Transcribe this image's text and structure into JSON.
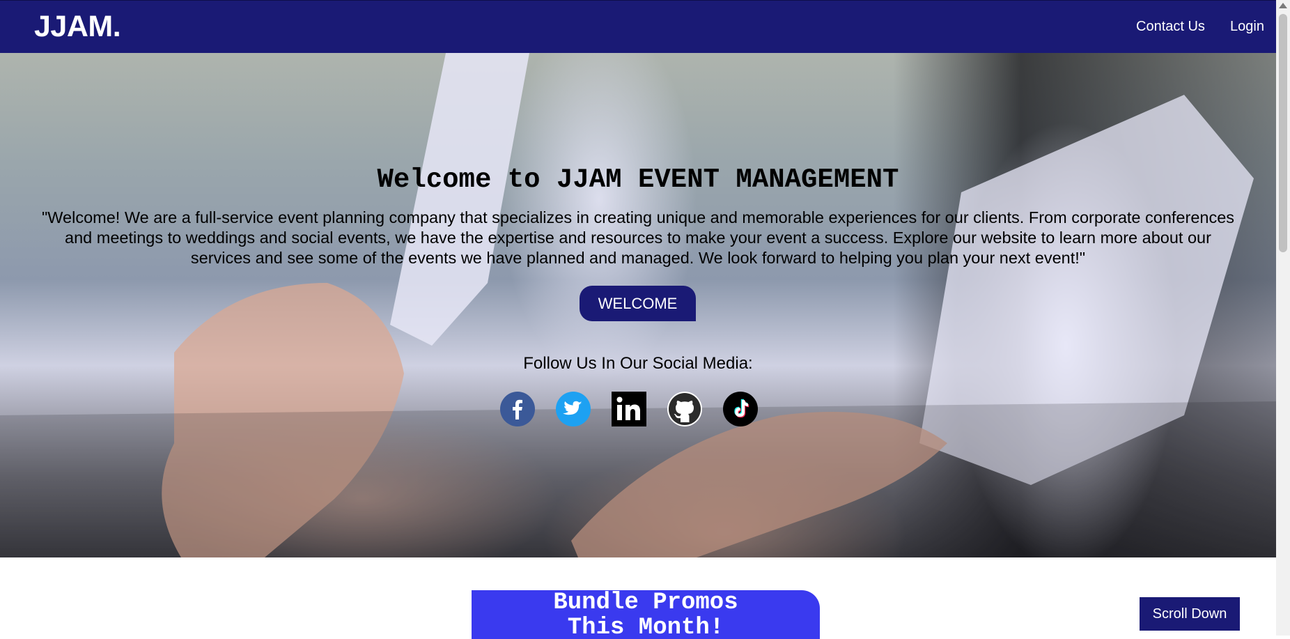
{
  "navbar": {
    "brand": "JJAM.",
    "links": [
      {
        "label": "Contact Us"
      },
      {
        "label": "Login"
      }
    ],
    "color": "#1a1a75"
  },
  "hero": {
    "title": "Welcome to JJAM EVENT MANAGEMENT",
    "text_lines": [
      "\"Welcome! We are a full-service event planning company that specializes in creating unique and memorable experiences for our clients. From corporate conferences",
      "and meetings to weddings and social events, we have the expertise and resources to make your event a success. Explore our website to learn more about our",
      "services and see some of the events we have planned and managed. We look forward to helping you plan your next event!\""
    ],
    "button_label": "WELCOME",
    "follow_text": "Follow Us In Our Social Media:",
    "socials": [
      {
        "icon": "facebook-icon",
        "color": "#3b5998"
      },
      {
        "icon": "twitter-icon",
        "color": "#1da1f2"
      },
      {
        "icon": "linkedin-icon",
        "color": "#000000"
      },
      {
        "icon": "github-icon",
        "color": "#ffffff"
      },
      {
        "icon": "tiktok-icon",
        "color": "#000000"
      }
    ]
  },
  "promo": {
    "title_lines": [
      "Bundle Promos",
      "This Month!"
    ],
    "color": "#3a3aef"
  },
  "scroll_button": {
    "label": "Scroll Down"
  }
}
